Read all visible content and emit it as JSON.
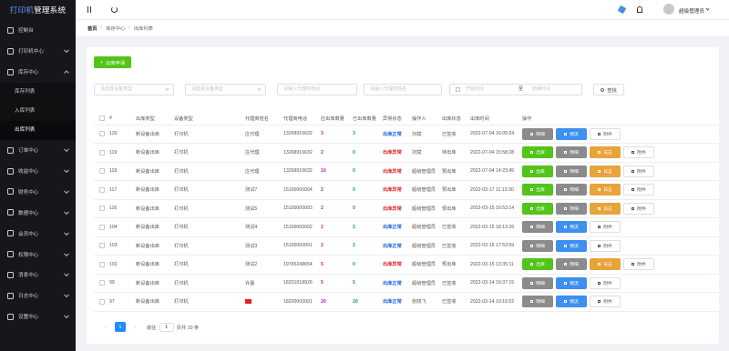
{
  "app": {
    "brand_pre": "打印机",
    "brand_post": "管理系统"
  },
  "sidebar": {
    "items": [
      {
        "label": "控制台",
        "expandable": false
      },
      {
        "label": "打印机中心",
        "expandable": true
      },
      {
        "label": "库存中心",
        "expandable": true,
        "open": true,
        "children": [
          {
            "label": "库存列表"
          },
          {
            "label": "入库列表"
          },
          {
            "label": "出库列表",
            "active": true
          }
        ]
      },
      {
        "label": "订单中心",
        "expandable": true
      },
      {
        "label": "收益中心",
        "expandable": true
      },
      {
        "label": "财务中心",
        "expandable": true
      },
      {
        "label": "数据中心",
        "expandable": true
      },
      {
        "label": "会员中心",
        "expandable": true
      },
      {
        "label": "权限中心",
        "expandable": true
      },
      {
        "label": "消息中心",
        "expandable": true
      },
      {
        "label": "日志中心",
        "expandable": true
      },
      {
        "label": "设置中心",
        "expandable": true
      }
    ]
  },
  "topbar": {
    "username": "超级管理员"
  },
  "breadcrumb": [
    "首页",
    "库存中心",
    "出库列表"
  ],
  "toolbar": {
    "outbound_apply": "出库申请"
  },
  "filters": {
    "type_placeholder": "请选择设备类型",
    "device_placeholder": "请选择设备类型",
    "agent_placeholder": "请输入代理商电话",
    "agent2_placeholder": "请输入代理商姓名",
    "start_placeholder": "开始时间",
    "range_sep": "至",
    "end_placeholder": "结束时间",
    "search_label": "查找"
  },
  "table": {
    "headers": [
      "#",
      "出库类型",
      "设备类型",
      "代理商姓名",
      "代理商电话",
      "应出库数量",
      "已出库数量",
      "异常状态",
      "操作人",
      "出库状态",
      "出库时间",
      "操作"
    ],
    "rows": [
      {
        "id": "120",
        "type": "新设备出库",
        "device": "打印机",
        "agent": "庄代理",
        "phone": "13268916632",
        "should": "3",
        "done": "3",
        "abn": "出库正常",
        "abn_ok": true,
        "op": "刘斌",
        "status": "已签收",
        "time": "2022-07-04 16:05:24",
        "actions": [
          "明细",
          "物流",
          "附件"
        ]
      },
      {
        "id": "119",
        "type": "新设备出库",
        "device": "打印机",
        "agent": "庄代理",
        "phone": "13268916632",
        "should": "2",
        "done": "0",
        "abn": "出库异常",
        "abn_ok": false,
        "op": "刘斌",
        "status": "待出库",
        "time": "2022-07-04 15:58:28",
        "actions": [
          "出库",
          "明细",
          "日志",
          "附件"
        ]
      },
      {
        "id": "118",
        "type": "新设备出库",
        "device": "打印机",
        "agent": "庄代理",
        "phone": "13268916632",
        "should": "10",
        "done": "0",
        "abn": "出库异常",
        "abn_ok": false,
        "op": "超级管理员",
        "status": "预出库",
        "time": "2022-07-04 14:23:45",
        "actions": [
          "出库",
          "明细",
          "日志",
          "附件"
        ]
      },
      {
        "id": "117",
        "type": "新设备出库",
        "device": "打印机",
        "agent": "测试7",
        "phone": "15100000004",
        "should": "2",
        "done": "0",
        "abn": "出库异常",
        "abn_ok": false,
        "op": "超级管理员",
        "status": "预出库",
        "time": "2022-03-17 11:13:30",
        "actions": [
          "出库",
          "明细",
          "日志",
          "附件"
        ]
      },
      {
        "id": "116",
        "type": "新设备出库",
        "device": "打印机",
        "agent": "测试5",
        "phone": "15100000003",
        "should": "2",
        "done": "0",
        "abn": "出库异常",
        "abn_ok": false,
        "op": "超级管理员",
        "status": "预出库",
        "time": "2022-03-15 16:53:14",
        "actions": [
          "出库",
          "明细",
          "日志",
          "附件"
        ]
      },
      {
        "id": "104",
        "type": "新设备出库",
        "device": "打印机",
        "agent": "测试4",
        "phone": "15100000002",
        "should": "2",
        "done": "2",
        "abn": "出库正常",
        "abn_ok": true,
        "op": "超级管理员",
        "status": "已签收",
        "time": "2022-03-15 18:13:26",
        "actions": [
          "明细",
          "物流",
          "附件"
        ]
      },
      {
        "id": "103",
        "type": "新设备出库",
        "device": "打印机",
        "agent": "测试3",
        "phone": "15100000001",
        "should": "2",
        "done": "2",
        "abn": "出库正常",
        "abn_ok": true,
        "op": "超级管理员",
        "status": "已签收",
        "time": "2022-03-15 17:53:59",
        "actions": [
          "明细",
          "物流",
          "附件"
        ]
      },
      {
        "id": "102",
        "type": "新设备出库",
        "device": "打印机",
        "agent": "测试2",
        "phone": "19765248654",
        "should": "5",
        "done": "0",
        "abn": "出库异常",
        "abn_ok": false,
        "op": "超级管理员",
        "status": "预出库",
        "time": "2022-03-15 13:35:11",
        "actions": [
          "出库",
          "明细",
          "日志",
          "附件"
        ]
      },
      {
        "id": "99",
        "type": "新设备出库",
        "device": "打印机",
        "agent": "许嘉",
        "phone": "18201018926",
        "should": "5",
        "done": "5",
        "abn": "出库正常",
        "abn_ok": true,
        "op": "超级管理员",
        "status": "已签收",
        "time": "2022-03-14 19:37:15",
        "actions": [
          "明细",
          "物流",
          "附件"
        ]
      },
      {
        "id": "97",
        "type": "新设备出库",
        "device": "打印机",
        "agent": "",
        "flag": true,
        "phone": "18200000001",
        "should": "20",
        "done": "20",
        "abn": "出库正常",
        "abn_ok": true,
        "op": "张晓飞",
        "status": "已签收",
        "time": "2022-03-14 10:16:52",
        "actions": [
          "明细",
          "物流",
          "附件"
        ]
      }
    ]
  },
  "pagination": {
    "goto_label": "前往",
    "page_value": "1",
    "current": "1",
    "suffix": "页共 10 条"
  },
  "colors": {
    "sidebar_bg": "#17171b",
    "accent": "#1e8cff",
    "green": "#52c41a",
    "orange": "#e8a33a",
    "blue": "#3d8ff0",
    "gray": "#8b8b8b"
  }
}
